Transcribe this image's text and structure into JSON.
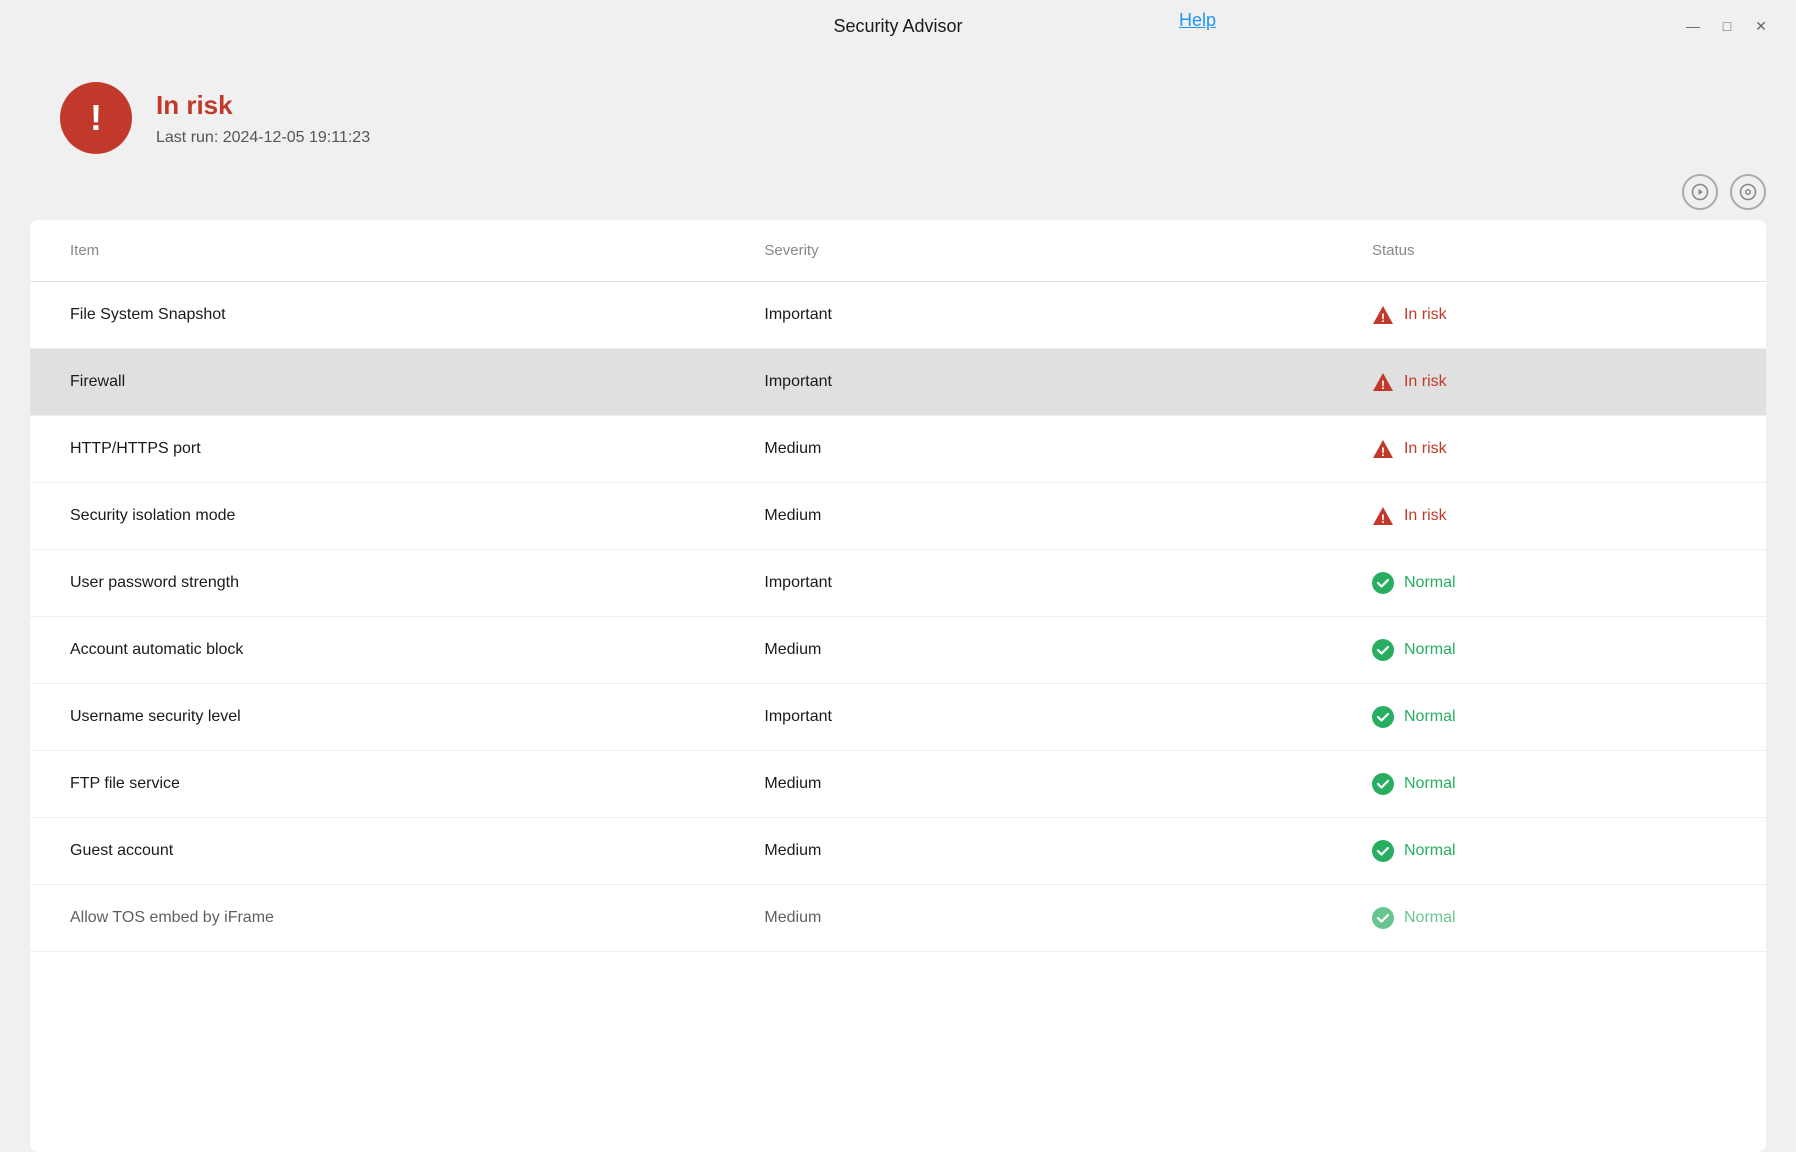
{
  "window": {
    "title": "Security Advisor",
    "help_link": "Help"
  },
  "window_controls": {
    "minimize": "—",
    "maximize": "□",
    "close": "✕"
  },
  "status": {
    "label": "In risk",
    "last_run_prefix": "Last run:",
    "last_run_time": "2024-12-05 19:11:23",
    "last_run_full": "Last run: 2024-12-05 19:11:23"
  },
  "table": {
    "columns": {
      "item": "Item",
      "severity": "Severity",
      "status": "Status"
    },
    "rows": [
      {
        "item": "File System Snapshot",
        "severity": "Important",
        "status": "In risk",
        "status_type": "risk",
        "highlighted": false
      },
      {
        "item": "Firewall",
        "severity": "Important",
        "status": "In risk",
        "status_type": "risk",
        "highlighted": true
      },
      {
        "item": "HTTP/HTTPS port",
        "severity": "Medium",
        "status": "In risk",
        "status_type": "risk",
        "highlighted": false
      },
      {
        "item": "Security isolation mode",
        "severity": "Medium",
        "status": "In risk",
        "status_type": "risk",
        "highlighted": false
      },
      {
        "item": "User password strength",
        "severity": "Important",
        "status": "Normal",
        "status_type": "normal",
        "highlighted": false
      },
      {
        "item": "Account automatic block",
        "severity": "Medium",
        "status": "Normal",
        "status_type": "normal",
        "highlighted": false
      },
      {
        "item": "Username security level",
        "severity": "Important",
        "status": "Normal",
        "status_type": "normal",
        "highlighted": false
      },
      {
        "item": "FTP file service",
        "severity": "Medium",
        "status": "Normal",
        "status_type": "normal",
        "highlighted": false
      },
      {
        "item": "Guest account",
        "severity": "Medium",
        "status": "Normal",
        "status_type": "normal",
        "highlighted": false
      },
      {
        "item": "Allow TOS embed by iFrame",
        "severity": "Medium",
        "status": "Normal",
        "status_type": "normal",
        "highlighted": false,
        "partial": true
      }
    ]
  }
}
